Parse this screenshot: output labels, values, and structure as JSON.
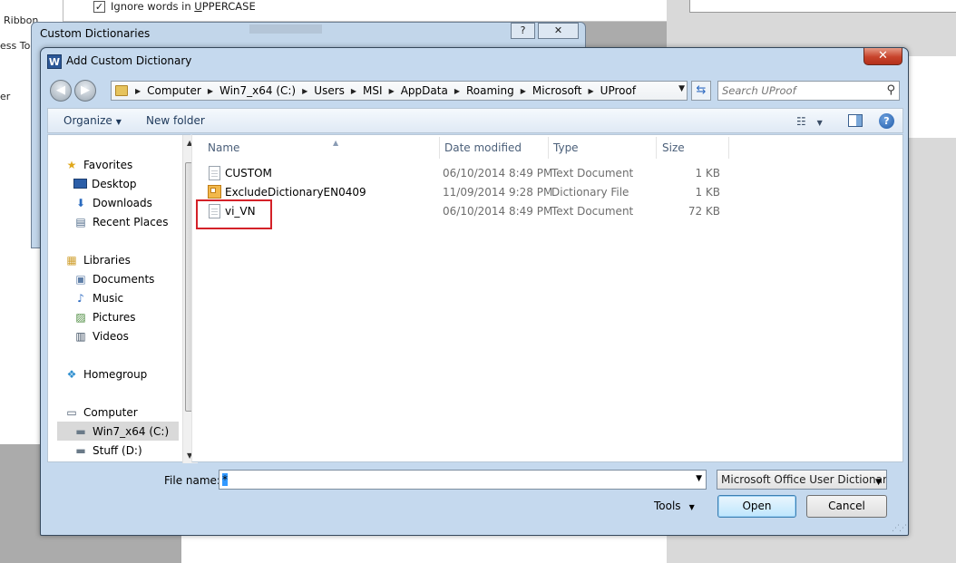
{
  "background": {
    "left_texts": [
      "Ribbon",
      "ess Too",
      "er"
    ],
    "checkbox_label_prefix": "Ignore words in ",
    "checkbox_label_underlined": "U",
    "checkbox_label_rest": "PPERCASE",
    "checkbox_mark": "✓"
  },
  "custom_dictionaries": {
    "title": "Custom Dictionaries",
    "help_label": "?",
    "close_label": "✕"
  },
  "dialog": {
    "title": "Add Custom Dictionary",
    "app_icon_letter": "W",
    "close_label": "✕"
  },
  "address": {
    "crumbs": [
      "Computer",
      "Win7_x64 (C:)",
      "Users",
      "MSI",
      "AppData",
      "Roaming",
      "Microsoft",
      "UProof"
    ],
    "search_placeholder": "Search UProof"
  },
  "toolbar": {
    "organize": "Organize",
    "new_folder": "New folder",
    "help": "?"
  },
  "nav": {
    "items": [
      {
        "label": "Favorites",
        "icon": "star-icon"
      },
      {
        "label": "Desktop",
        "icon": "desktop-icon"
      },
      {
        "label": "Downloads",
        "icon": "downloads-icon"
      },
      {
        "label": "Recent Places",
        "icon": "recent-places-icon"
      },
      {
        "label": "Libraries",
        "icon": "libraries-icon"
      },
      {
        "label": "Documents",
        "icon": "documents-icon"
      },
      {
        "label": "Music",
        "icon": "music-icon"
      },
      {
        "label": "Pictures",
        "icon": "pictures-icon"
      },
      {
        "label": "Videos",
        "icon": "videos-icon"
      },
      {
        "label": "Homegroup",
        "icon": "homegroup-icon"
      },
      {
        "label": "Computer",
        "icon": "computer-icon"
      },
      {
        "label": "Win7_x64 (C:)",
        "icon": "drive-icon"
      },
      {
        "label": "Stuff (D:)",
        "icon": "drive-icon"
      }
    ]
  },
  "files": {
    "columns": [
      "Name",
      "Date modified",
      "Type",
      "Size"
    ],
    "rows": [
      {
        "name": "CUSTOM",
        "date": "06/10/2014 8:49 PM",
        "type": "Text Document",
        "size": "1 KB",
        "icon": "text-document-icon"
      },
      {
        "name": "ExcludeDictionaryEN0409",
        "date": "11/09/2014 9:28 PM",
        "type": "Dictionary File",
        "size": "1 KB",
        "icon": "dictionary-file-icon"
      },
      {
        "name": "vi_VN",
        "date": "06/10/2014 8:49 PM",
        "type": "Text Document",
        "size": "72 KB",
        "icon": "text-document-icon"
      }
    ],
    "highlight_color": "#d42128"
  },
  "bottom": {
    "filename_label": "File name:",
    "filename_value": "*",
    "filetype_value": "Microsoft Office User Dictionar",
    "tools_label": "Tools",
    "open_label": "Open",
    "cancel_label": "Cancel"
  }
}
